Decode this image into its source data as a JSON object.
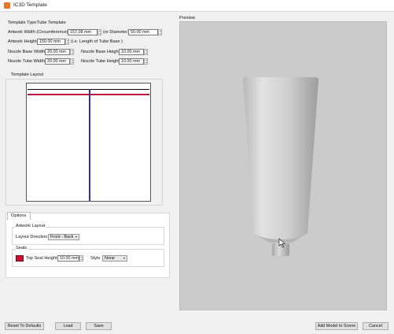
{
  "window": {
    "title": "IC3D Template"
  },
  "fields": {
    "template_type_label": "Template Type:",
    "template_type_value": "Tube Template",
    "artwork_width_label": "Artwork Width (Circumference)",
    "artwork_width_value": "157.08 mm",
    "diameter_label": "(or Diameter)",
    "diameter_value": "50.00 mm",
    "artwork_height_label": "Artwork Height",
    "artwork_height_value": "150.00 mm",
    "artwork_height_note": "(i.e. Length of Tube Base )",
    "nozzle_base_width_label": "Nozzle Base Width",
    "nozzle_base_width_value": "20.00 mm",
    "nozzle_base_height_label": "Nozzle Base Height",
    "nozzle_base_height_value": "10.00 mm",
    "nozzle_tube_width_label": "Nozzle Tube Width",
    "nozzle_tube_width_value": "20.00 mm",
    "nozzle_tube_height_label": "Nozzle Tube Height",
    "nozzle_tube_height_value": "10.00 mm"
  },
  "template_layout": {
    "title": "Template Layout"
  },
  "options": {
    "tab_label": "Options",
    "artwork_layout": {
      "group_title": "Artwork Layout",
      "direction_label": "Layout Direction",
      "direction_value": "Front - Back"
    },
    "seals": {
      "group_title": "Seals",
      "seal_color": "#c8102e",
      "top_seal_height_label": "Top Seal Height",
      "top_seal_height_value": "10.00 mm",
      "style_label": "Style",
      "style_value": "None"
    }
  },
  "preview": {
    "label": "Preview"
  },
  "buttons": {
    "reset": "Reset To Defaults",
    "load": "Load",
    "save": "Save",
    "add_model": "Add Model to Scene",
    "cancel": "Cancel"
  }
}
